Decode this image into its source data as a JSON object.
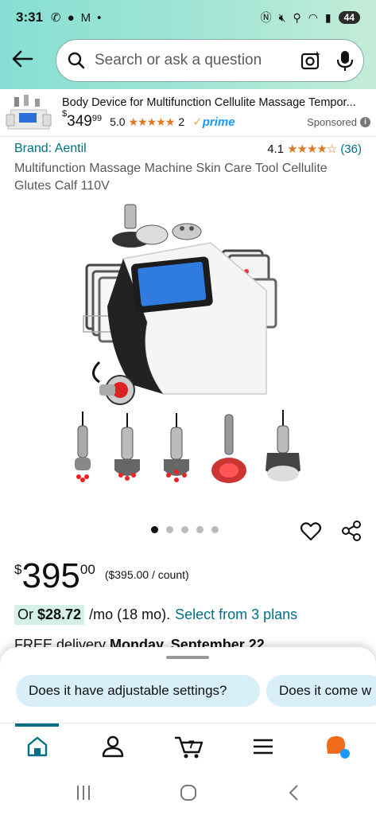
{
  "status_bar": {
    "time": "3:31",
    "battery": "44"
  },
  "search": {
    "placeholder": "Search or ask a question"
  },
  "sponsored_ad": {
    "title": "Body Device for Multifunction Cellulite Massage Tempor...",
    "price_symbol": "$",
    "price_whole": "349",
    "price_cents": "99",
    "rating": "5.0",
    "stars": "★★★★★",
    "review_count": "2",
    "prime_label": "prime",
    "sponsored_label": "Sponsored"
  },
  "product": {
    "brand": "Brand: Aentil",
    "rating": "4.1",
    "stars": "★★★★☆",
    "review_count": "(36)",
    "title": "Multifunction Massage Machine Skin Care Tool Cellulite Glutes Calf 110V",
    "image_dots": 5,
    "active_dot": 0
  },
  "price": {
    "symbol": "$",
    "whole": "395",
    "cents": "00",
    "per_unit": "($395.00 / count)"
  },
  "finance": {
    "prefix": "Or",
    "amount": "$28.72",
    "term": "/mo (18 mo).",
    "link": "Select from 3 plans"
  },
  "delivery": {
    "text_prefix": "FREE delivery",
    "date": "Monday, September 22"
  },
  "rufus": {
    "chips": [
      "Does it have adjustable settings?",
      "Does it come w"
    ]
  },
  "bottom_nav": {
    "cart_count": "7",
    "items": [
      "home-icon",
      "account-icon",
      "cart-icon",
      "menu-icon",
      "rufus-icon"
    ]
  },
  "colors": {
    "header_gradient_start": "#86dfd4",
    "link": "#007185",
    "star": "#de7921",
    "finance_highlight": "#d5f1e6",
    "chip": "#d8eef9"
  }
}
